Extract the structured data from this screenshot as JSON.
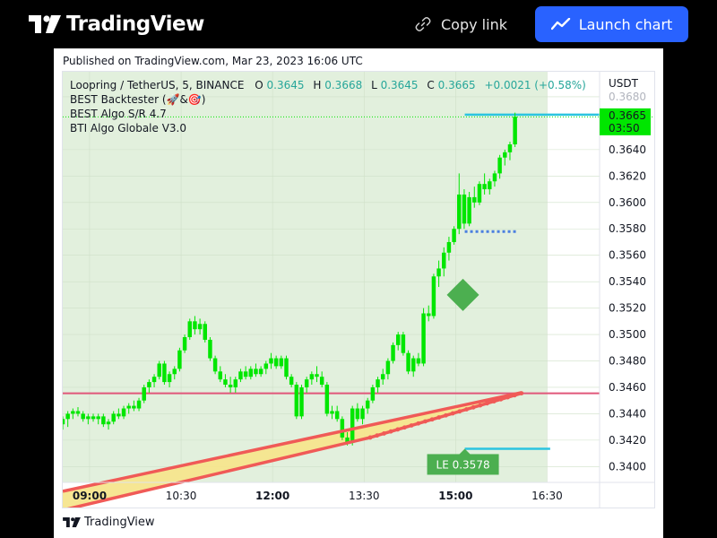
{
  "header": {
    "brand": "TradingView",
    "copy_link_label": "Copy link",
    "launch_chart_label": "Launch chart",
    "accent_color": "#2962ff"
  },
  "published_text": "Published on TradingView.com, Mar 23, 2023 16:06 UTC",
  "footer_brand": "TradingView",
  "legend": {
    "symbol": "Loopring / TetherUS, 5, BINANCE",
    "o_label": "O",
    "o_value": "0.3645",
    "h_label": "H",
    "h_value": "0.3668",
    "l_label": "L",
    "l_value": "0.3645",
    "c_label": "C",
    "c_value": "0.3665",
    "change": "+0.0021 (+0.58%)",
    "indicators": [
      "BEST Backtester (🚀&🎯)",
      "BEST Algo S/R 4.7",
      "BTI Algo Globale V3.0"
    ]
  },
  "chart_data": {
    "type": "candlestick",
    "title": "Loopring / TetherUS, 5, BINANCE",
    "currency": "USDT",
    "x_ticks": [
      {
        "label": "09:00",
        "t": 0.0,
        "bold": true
      },
      {
        "label": "10:30",
        "t": 1.5,
        "bold": false
      },
      {
        "label": "12:00",
        "t": 3.0,
        "bold": true
      },
      {
        "label": "13:30",
        "t": 4.5,
        "bold": false
      },
      {
        "label": "15:00",
        "t": 6.0,
        "bold": true
      },
      {
        "label": "16:30",
        "t": 7.5,
        "bold": false
      }
    ],
    "y_ticks": [
      0.368,
      0.364,
      0.362,
      0.36,
      0.358,
      0.356,
      0.354,
      0.352,
      0.35,
      0.348,
      0.346,
      0.344,
      0.342,
      0.34
    ],
    "ylim": [
      0.3388,
      0.3699
    ],
    "xlim": [
      -0.44,
      8.36
    ],
    "last_price": "0.3665",
    "countdown": "03:50",
    "candle_color": "#00e600",
    "entry_label": "LE 0.3578",
    "entry_diamond": {
      "t": 6.12,
      "price": 0.353
    },
    "entry_level": 0.3578,
    "entry_level_range": [
      6.15,
      7.0
    ],
    "resistance_level": 0.36665,
    "resistance_range": [
      6.15,
      8.36
    ],
    "support_level": 0.34135,
    "support_range": [
      6.15,
      7.55
    ],
    "horizontal_line": 0.34555,
    "trend_line_1": [
      [
        -0.44,
        0.33813
      ],
      [
        7.08,
        0.3456
      ]
    ],
    "trend_line_2": [
      [
        -0.44,
        0.3367
      ],
      [
        4.6,
        0.3422
      ],
      [
        7.08,
        0.34555
      ]
    ],
    "ohlc_start": -0.44,
    "ohlc_step": 0.0833,
    "ohlc": [
      [
        0.3432,
        0.3438,
        0.3428,
        0.3436
      ],
      [
        0.3436,
        0.3442,
        0.343,
        0.344
      ],
      [
        0.344,
        0.3444,
        0.3436,
        0.3442
      ],
      [
        0.3442,
        0.3445,
        0.3438,
        0.344
      ],
      [
        0.344,
        0.3442,
        0.3434,
        0.3436
      ],
      [
        0.3436,
        0.344,
        0.3432,
        0.3438
      ],
      [
        0.3438,
        0.344,
        0.3434,
        0.3436
      ],
      [
        0.3436,
        0.344,
        0.3432,
        0.3438
      ],
      [
        0.3438,
        0.344,
        0.343,
        0.3432
      ],
      [
        0.3432,
        0.3436,
        0.3428,
        0.3434
      ],
      [
        0.3434,
        0.3442,
        0.3432,
        0.344
      ],
      [
        0.344,
        0.3444,
        0.3436,
        0.3438
      ],
      [
        0.3438,
        0.3446,
        0.3436,
        0.3444
      ],
      [
        0.3444,
        0.3448,
        0.344,
        0.3446
      ],
      [
        0.3446,
        0.345,
        0.3442,
        0.3444
      ],
      [
        0.3444,
        0.3452,
        0.3442,
        0.345
      ],
      [
        0.345,
        0.3462,
        0.3448,
        0.346
      ],
      [
        0.346,
        0.3466,
        0.3456,
        0.3464
      ],
      [
        0.3464,
        0.347,
        0.346,
        0.3468
      ],
      [
        0.3468,
        0.348,
        0.3466,
        0.3478
      ],
      [
        0.3478,
        0.348,
        0.3462,
        0.3464
      ],
      [
        0.3464,
        0.3472,
        0.346,
        0.347
      ],
      [
        0.347,
        0.3476,
        0.3466,
        0.3474
      ],
      [
        0.3474,
        0.349,
        0.3472,
        0.3488
      ],
      [
        0.3488,
        0.35,
        0.3486,
        0.3498
      ],
      [
        0.3498,
        0.3512,
        0.3496,
        0.351
      ],
      [
        0.351,
        0.3514,
        0.35,
        0.3504
      ],
      [
        0.3504,
        0.3512,
        0.35,
        0.3508
      ],
      [
        0.3508,
        0.351,
        0.3494,
        0.3496
      ],
      [
        0.3496,
        0.3498,
        0.348,
        0.3482
      ],
      [
        0.3482,
        0.3484,
        0.347,
        0.3472
      ],
      [
        0.3472,
        0.3476,
        0.3464,
        0.3466
      ],
      [
        0.3466,
        0.347,
        0.346,
        0.3462
      ],
      [
        0.3462,
        0.3468,
        0.3456,
        0.346
      ],
      [
        0.346,
        0.3468,
        0.3456,
        0.3466
      ],
      [
        0.3466,
        0.3474,
        0.3464,
        0.3472
      ],
      [
        0.3472,
        0.3476,
        0.3466,
        0.3468
      ],
      [
        0.3468,
        0.3476,
        0.3466,
        0.3474
      ],
      [
        0.3474,
        0.3478,
        0.3468,
        0.347
      ],
      [
        0.347,
        0.3476,
        0.3468,
        0.3474
      ],
      [
        0.3474,
        0.348,
        0.347,
        0.3478
      ],
      [
        0.3478,
        0.3486,
        0.3474,
        0.3482
      ],
      [
        0.3482,
        0.3484,
        0.3474,
        0.3476
      ],
      [
        0.3476,
        0.3484,
        0.3474,
        0.3482
      ],
      [
        0.3482,
        0.3484,
        0.3466,
        0.3468
      ],
      [
        0.3468,
        0.347,
        0.346,
        0.3462
      ],
      [
        0.3462,
        0.3464,
        0.3436,
        0.3438
      ],
      [
        0.3438,
        0.3462,
        0.3436,
        0.346
      ],
      [
        0.346,
        0.3468,
        0.3456,
        0.3466
      ],
      [
        0.3466,
        0.3472,
        0.3462,
        0.347
      ],
      [
        0.347,
        0.3476,
        0.3464,
        0.3468
      ],
      [
        0.3468,
        0.3472,
        0.346,
        0.3462
      ],
      [
        0.3462,
        0.3464,
        0.3438,
        0.344
      ],
      [
        0.344,
        0.3446,
        0.3436,
        0.3442
      ],
      [
        0.3442,
        0.3446,
        0.3434,
        0.3436
      ],
      [
        0.3436,
        0.3438,
        0.342,
        0.3422
      ],
      [
        0.3422,
        0.3426,
        0.3416,
        0.3418
      ],
      [
        0.3418,
        0.3446,
        0.3416,
        0.3444
      ],
      [
        0.3444,
        0.3448,
        0.3434,
        0.3436
      ],
      [
        0.3436,
        0.3446,
        0.3432,
        0.3444
      ],
      [
        0.3444,
        0.3452,
        0.344,
        0.345
      ],
      [
        0.345,
        0.3462,
        0.3448,
        0.346
      ],
      [
        0.346,
        0.3468,
        0.3456,
        0.3466
      ],
      [
        0.3466,
        0.3474,
        0.3462,
        0.347
      ],
      [
        0.347,
        0.3482,
        0.3466,
        0.348
      ],
      [
        0.348,
        0.3494,
        0.3478,
        0.3492
      ],
      [
        0.3492,
        0.3502,
        0.3488,
        0.35
      ],
      [
        0.35,
        0.3502,
        0.3484,
        0.3486
      ],
      [
        0.3486,
        0.3488,
        0.347,
        0.3472
      ],
      [
        0.3472,
        0.3484,
        0.3468,
        0.3482
      ],
      [
        0.3482,
        0.3486,
        0.3476,
        0.3478
      ],
      [
        0.3478,
        0.352,
        0.3476,
        0.3516
      ],
      [
        0.3516,
        0.3522,
        0.351,
        0.3514
      ],
      [
        0.3514,
        0.3546,
        0.3512,
        0.3544
      ],
      [
        0.3544,
        0.3556,
        0.3536,
        0.355
      ],
      [
        0.355,
        0.3566,
        0.3544,
        0.3562
      ],
      [
        0.3562,
        0.3574,
        0.3556,
        0.357
      ],
      [
        0.357,
        0.3582,
        0.3568,
        0.358
      ],
      [
        0.358,
        0.3622,
        0.3576,
        0.3606
      ],
      [
        0.3606,
        0.361,
        0.358,
        0.3584
      ],
      [
        0.3584,
        0.3608,
        0.3582,
        0.3604
      ],
      [
        0.3604,
        0.3612,
        0.3596,
        0.36
      ],
      [
        0.36,
        0.3616,
        0.3598,
        0.3614
      ],
      [
        0.3614,
        0.3622,
        0.3606,
        0.361
      ],
      [
        0.361,
        0.3618,
        0.3606,
        0.3616
      ],
      [
        0.3616,
        0.3624,
        0.3612,
        0.3622
      ],
      [
        0.3622,
        0.3636,
        0.3618,
        0.3634
      ],
      [
        0.3634,
        0.364,
        0.3628,
        0.3638
      ],
      [
        0.3638,
        0.3646,
        0.3632,
        0.3644
      ],
      [
        0.3644,
        0.3668,
        0.3642,
        0.3665
      ]
    ]
  }
}
